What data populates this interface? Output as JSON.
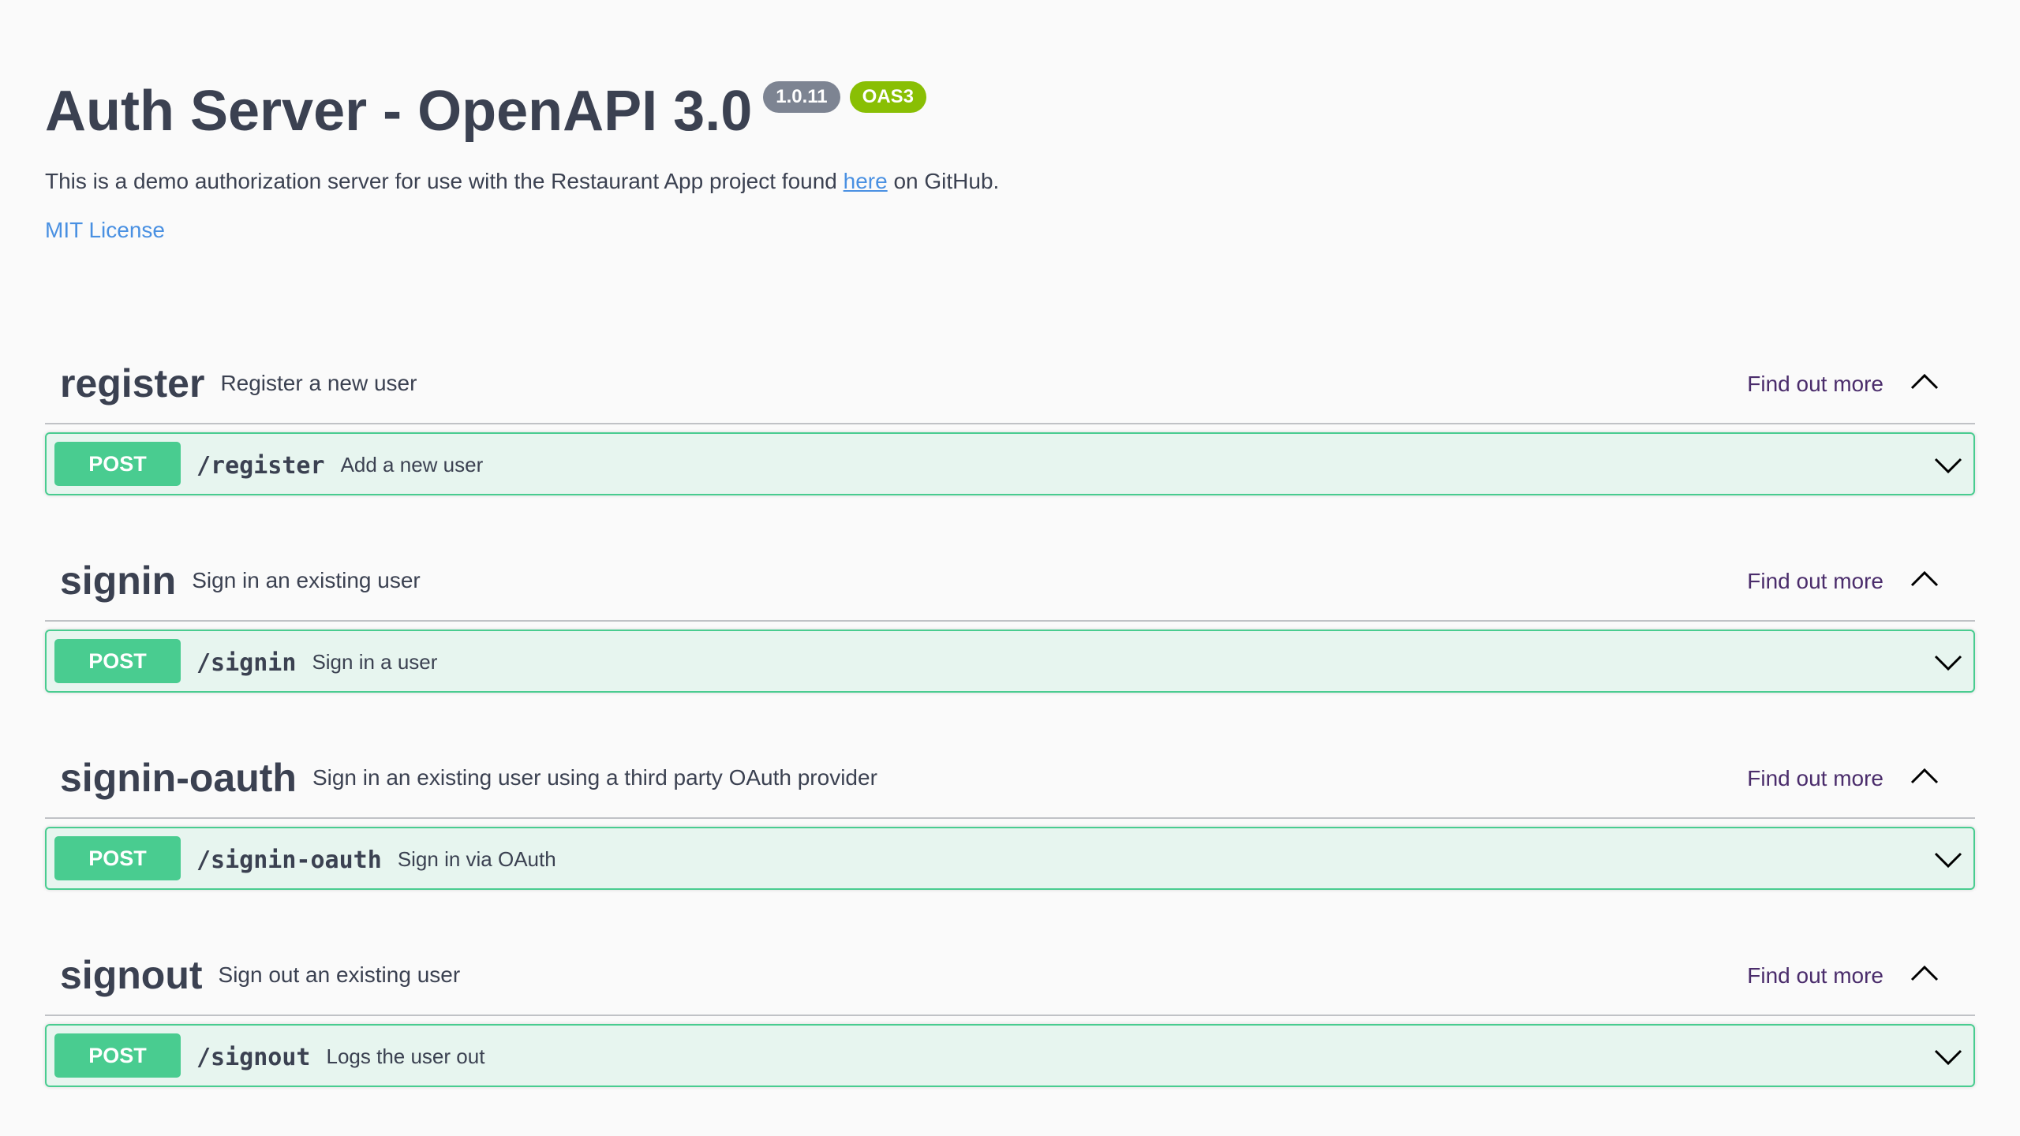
{
  "info": {
    "title": "Auth Server - OpenAPI 3.0",
    "version_badge": "1.0.11",
    "oas_badge": "OAS3",
    "description_before": "This is a demo authorization server for use with the Restaurant App project found ",
    "description_link": "here",
    "description_after": " on GitHub.",
    "license": "MIT License"
  },
  "colors": {
    "post": "#49cc90",
    "version_badge": "#7d8492",
    "oas_badge": "#89bf04",
    "link": "#4990e2",
    "find_out_more": "#4a2c6b"
  },
  "tags": [
    {
      "name": "register",
      "description": "Register a new user",
      "find_out_more": "Find out more",
      "operation": {
        "method": "POST",
        "path": "/register",
        "summary": "Add a new user"
      }
    },
    {
      "name": "signin",
      "description": "Sign in an existing user",
      "find_out_more": "Find out more",
      "operation": {
        "method": "POST",
        "path": "/signin",
        "summary": "Sign in a user"
      }
    },
    {
      "name": "signin-oauth",
      "description": "Sign in an existing user using a third party OAuth provider",
      "find_out_more": "Find out more",
      "operation": {
        "method": "POST",
        "path": "/signin-oauth",
        "summary": "Sign in via OAuth"
      }
    },
    {
      "name": "signout",
      "description": "Sign out an existing user",
      "find_out_more": "Find out more",
      "operation": {
        "method": "POST",
        "path": "/signout",
        "summary": "Logs the user out"
      }
    }
  ]
}
